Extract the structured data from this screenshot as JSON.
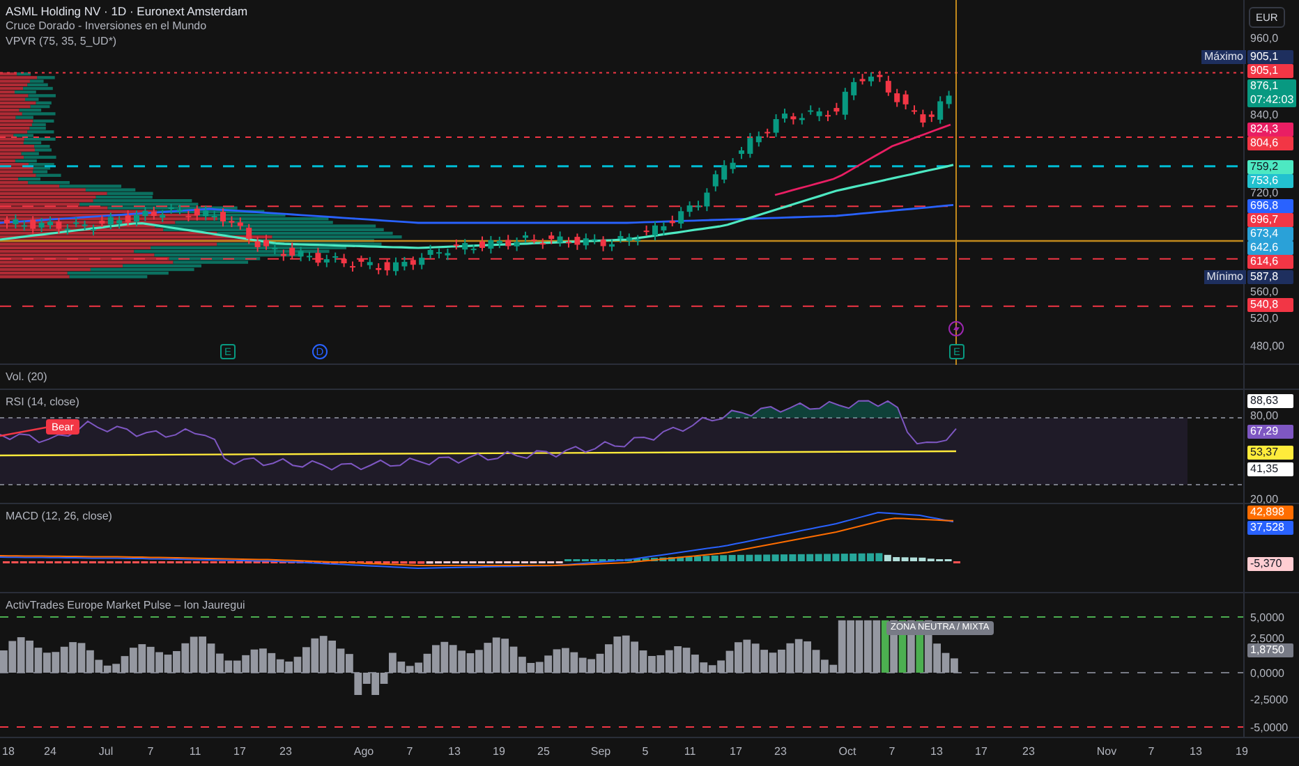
{
  "legend": {
    "symbol": "ASML Holding NV · 1D · Euronext Amsterdam",
    "indicators": [
      "Cruce Dorado - Inversiones en el Mundo",
      "VPVR (75, 35, 5_UD*)"
    ]
  },
  "currency": "EUR",
  "price_axis": {
    "ticks": [
      "960,0",
      "840,0",
      "720,0",
      "560,0",
      "520,0",
      "480,00"
    ],
    "labels": [
      {
        "note": "Máximo",
        "text": "905,1",
        "color": "#1e2f5e"
      },
      {
        "text": "905,1",
        "color": "#f23645"
      },
      {
        "text": "876,1",
        "sub": "07:42:03",
        "color": "#089981"
      },
      {
        "text": "824,3",
        "color": "#e91e63"
      },
      {
        "text": "804,6",
        "color": "#f23645"
      },
      {
        "text": "759,2",
        "color": "#4de8c2"
      },
      {
        "text": "753,6",
        "color": "#22c1cf"
      },
      {
        "text": "696,8",
        "color": "#2962ff"
      },
      {
        "text": "696,7",
        "color": "#f23645"
      },
      {
        "text": "673,4",
        "color": "#2aa1d8"
      },
      {
        "text": "642,6",
        "color": "#2aa1d8"
      },
      {
        "text": "614,6",
        "color": "#f23645"
      },
      {
        "note": "Mínimo",
        "text": "587,8",
        "color": "#1e2f5e"
      },
      {
        "text": "540,8",
        "color": "#f23645"
      }
    ]
  },
  "events": [
    {
      "kind": "earnings",
      "text": "E"
    },
    {
      "kind": "dividend",
      "text": "D"
    },
    {
      "kind": "earnings",
      "text": "E"
    }
  ],
  "volume": {
    "title": "Vol. (20)"
  },
  "rsi": {
    "title": "RSI (14, close)",
    "signal": "Bear",
    "ticks": [
      "80,00",
      "20,00"
    ],
    "labels": [
      {
        "text": "88,63",
        "color": "#ffffff"
      },
      {
        "text": "67,29",
        "color": "#7e57c2"
      },
      {
        "text": "53,37",
        "color": "#ffeb3b"
      },
      {
        "text": "41,35",
        "color": "#ffffff"
      }
    ]
  },
  "macd": {
    "title": "MACD (12, 26, close)",
    "labels": [
      {
        "text": "42,898",
        "color": "#ff6d00"
      },
      {
        "text": "37,528",
        "color": "#2962ff"
      },
      {
        "text": "-5,370",
        "color": "#ffcdd2"
      }
    ]
  },
  "pulse": {
    "title": "ActivTrades Europe Market Pulse – Ion Jauregui",
    "annotation": "ZONA NEUTRA / MIXTA",
    "ticks": [
      "5,0000",
      "2,5000",
      "0,0000",
      "-2,5000",
      "-5,0000"
    ],
    "labels": [
      {
        "text": "1,8750",
        "color": "#787b86"
      }
    ]
  },
  "time_axis": [
    "18",
    "24",
    "Jul",
    "7",
    "11",
    "17",
    "23",
    "Ago",
    "7",
    "13",
    "19",
    "25",
    "Sep",
    "5",
    "11",
    "17",
    "23",
    "Oct",
    "7",
    "13",
    "17",
    "23",
    "Nov",
    "7",
    "13",
    "19"
  ]
}
